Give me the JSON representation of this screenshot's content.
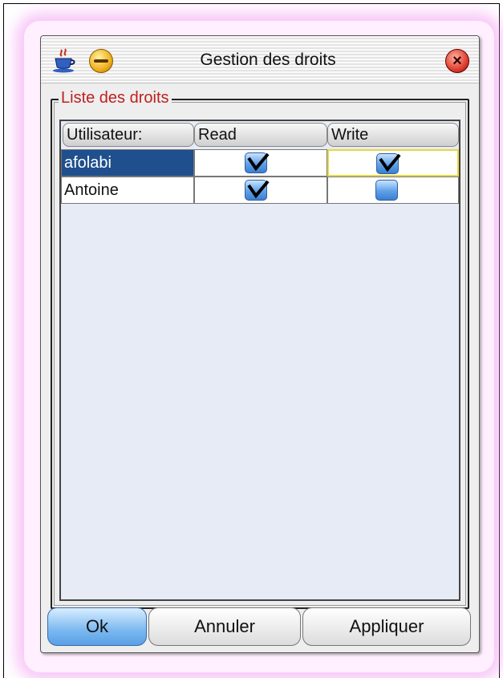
{
  "window": {
    "title": "Gestion des droits"
  },
  "group": {
    "legend": "Liste des droits"
  },
  "table": {
    "columns": [
      "Utilisateur:",
      "Read",
      "Write"
    ],
    "rows": [
      {
        "user": "afolabi",
        "read": true,
        "write": true,
        "selected": true
      },
      {
        "user": "Antoine",
        "read": true,
        "write": false,
        "selected": false
      }
    ]
  },
  "buttons": {
    "ok": "Ok",
    "cancel": "Annuler",
    "apply": "Appliquer"
  },
  "icons": {
    "app": "java-cup-icon",
    "minimize": "minimize-icon",
    "close": "close-icon"
  },
  "colors": {
    "legend_text": "#c02020",
    "selection": "#1f4f8c",
    "checkbox": "#5fa0e8",
    "window_glow": "#f096f0"
  }
}
